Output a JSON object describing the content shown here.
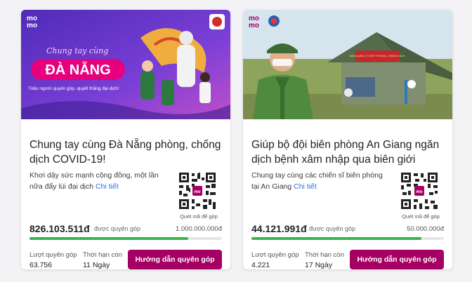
{
  "campaigns": [
    {
      "banner": {
        "logo": "mo\nmo",
        "script_text": "Chung tay cùng",
        "headline": "ĐÀ NẴNG",
        "tagline": "Triệu người quyên góp, quyết thắng đại dịch!",
        "colors": {
          "bg": "#6a3bd2",
          "accent": "#e6007e"
        }
      },
      "title": "Chung tay cùng Đà Nẵng phòng, chống dịch COVID-19!",
      "description": "Khơi dậy sức mạnh cộng đồng, một lần nữa đẩy lùi đại dịch ",
      "more_link": "Chi tiết",
      "qr_caption": "Quét mã để góp",
      "amount": "826.103.511đ",
      "amount_suffix": "được quyên góp",
      "goal": "1.000.000.000đ",
      "progress": 0.826,
      "donations_label": "Lượt quyên góp",
      "donations": "63.756",
      "deadline_label": "Thời hạn còn",
      "deadline": "11 Ngày",
      "cta": "Hướng dẫn quyên góp"
    },
    {
      "banner": {
        "logo": "mo\nmo",
        "sign_text": "BAN QUẢN LÝ CHỐT PHÒNG, CHỐNG DỊCH",
        "colors": {
          "sky": "#cfe0ee",
          "field": "#8ea35c"
        }
      },
      "title": "Giúp bộ đội biên phòng An Giang ngăn dịch bệnh xâm nhập qua biên giới",
      "description": "Chung tay cùng các chiến sĩ biên phòng tại An Giang ",
      "more_link": "Chi tiết",
      "qr_caption": "Quét mã để góp",
      "amount": "44.121.991đ",
      "amount_suffix": "được quyên góp",
      "goal": "50.000.000đ",
      "progress": 0.882,
      "donations_label": "Lượt quyên góp",
      "donations": "4.221",
      "deadline_label": "Thời hạn còn",
      "deadline": "17 Ngày",
      "cta": "Hướng dẫn quyên góp"
    }
  ]
}
